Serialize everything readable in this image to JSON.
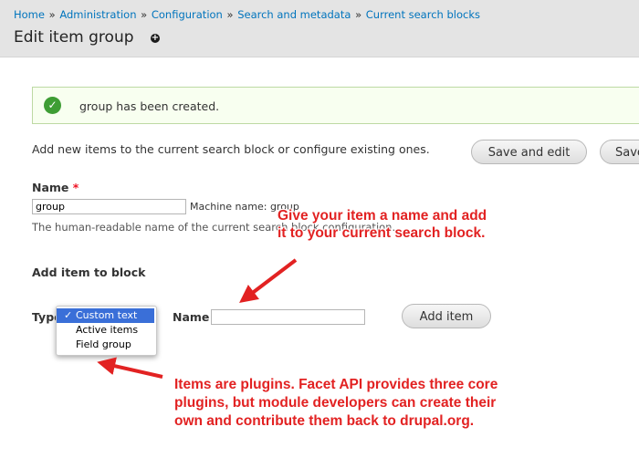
{
  "breadcrumb": [
    {
      "label": "Home"
    },
    {
      "label": "Administration"
    },
    {
      "label": "Configuration"
    },
    {
      "label": "Search and metadata"
    },
    {
      "label": "Current search blocks"
    }
  ],
  "breadcrumb_separator": "»",
  "page": {
    "title": "Edit item group",
    "shortcut_icon": "plus-circle-icon",
    "shortcut_glyph": "+"
  },
  "status": {
    "message": "group has been created.",
    "icon": "check-circle-icon",
    "glyph": "✓",
    "color": "#3e9d34"
  },
  "intro": "Add new items to the current search block or configure existing ones.",
  "actions": {
    "save_and_edit": "Save and edit",
    "save": "Save"
  },
  "name_field": {
    "label": "Name",
    "required_mark": "*",
    "value": "group",
    "machine_name": "Machine name: group",
    "description": "The human-readable name of the current search block configuration."
  },
  "add_item": {
    "heading": "Add item to block",
    "type_label": "Type",
    "type_options": [
      {
        "label": "Custom text",
        "selected": true
      },
      {
        "label": "Active items",
        "selected": false
      },
      {
        "label": "Field group",
        "selected": false
      }
    ],
    "selected_glyph": "✓",
    "name_label": "Name",
    "name_value": "",
    "button": "Add item"
  },
  "annotations": {
    "top": [
      "Give your item a name and add",
      "it to your current search block."
    ],
    "bottom": [
      "Items are plugins. Facet API provides three core",
      "plugins, but module developers can create their",
      "own and contribute them back to drupal.org."
    ],
    "color": "#e22222"
  }
}
